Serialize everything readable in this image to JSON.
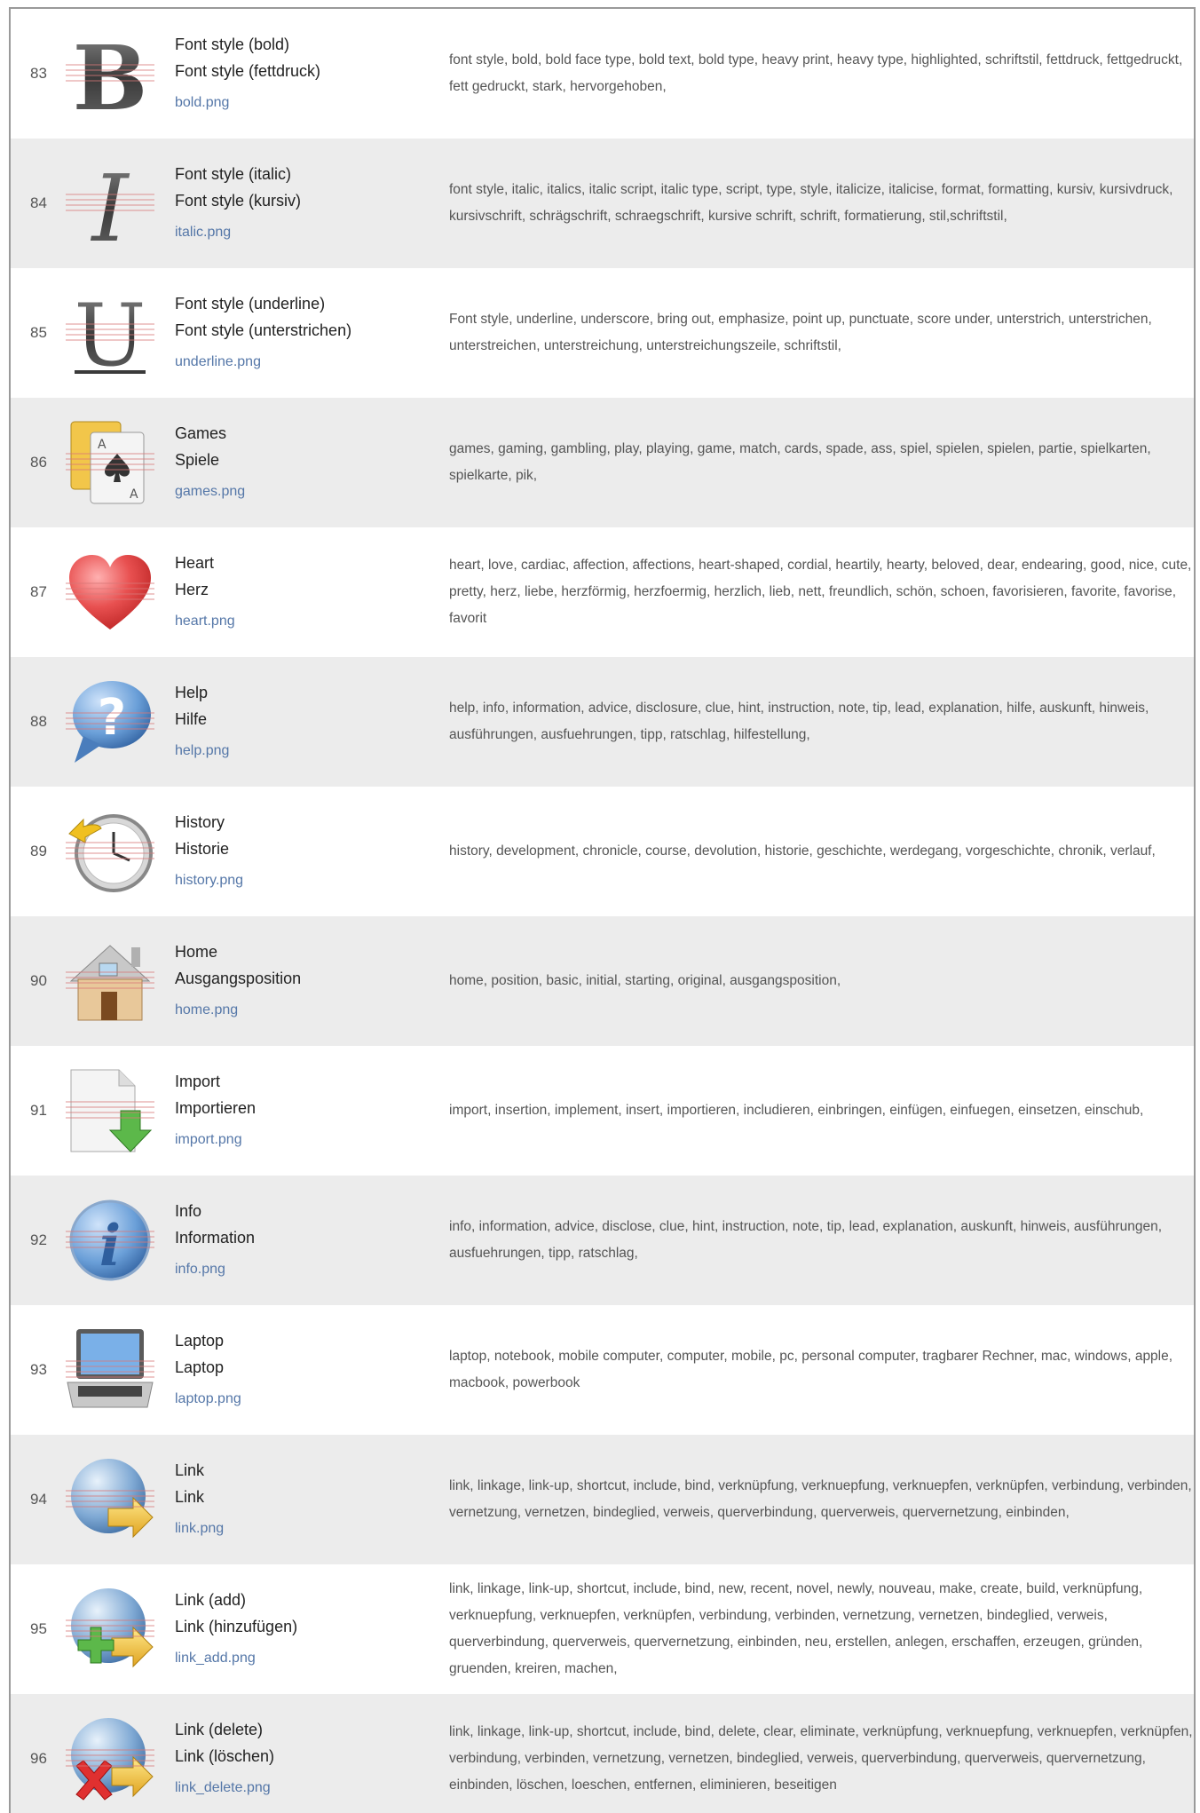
{
  "rows": [
    {
      "num": "83",
      "en": "Font style (bold)",
      "de": "Font style (fettdruck)",
      "file": "bold.png",
      "icon": "bold-icon",
      "keywords": "font style, bold, bold face type, bold text, bold type, heavy print, heavy type, highlighted, schriftstil, fettdruck, fettgedruckt, fett gedruckt, stark, hervorgehoben,"
    },
    {
      "num": "84",
      "en": "Font style (italic)",
      "de": "Font style (kursiv)",
      "file": "italic.png",
      "icon": "italic-icon",
      "keywords": "font style, italic, italics, italic script, italic type, script, type, style, italicize, italicise, format, formatting, kursiv, kursivdruck, kursivschrift, schrägschrift, schraegschrift, kursive schrift, schrift, formatierung, stil,schriftstil,"
    },
    {
      "num": "85",
      "en": "Font style (underline)",
      "de": "Font style (unterstrichen)",
      "file": "underline.png",
      "icon": "underline-icon",
      "keywords": "Font style, underline, underscore, bring out, emphasize, point up, punctuate, score under, unterstrich, unterstrichen, unterstreichen, unterstreichung, unterstreichungszeile, schriftstil,"
    },
    {
      "num": "86",
      "en": "Games",
      "de": "Spiele",
      "file": "games.png",
      "icon": "playing-cards-icon",
      "keywords": "games, gaming, gambling, play, playing, game, match, cards, spade, ass, spiel, spielen, spielen, partie, spielkarten, spielkarte, pik,"
    },
    {
      "num": "87",
      "en": "Heart",
      "de": "Herz",
      "file": "heart.png",
      "icon": "heart-icon",
      "keywords": "heart, love, cardiac, affection, affections, heart-shaped, cordial, heartily, hearty, beloved, dear, endearing, good, nice, cute, pretty, herz, liebe, herzförmig, herzfoermig, herzlich, lieb, nett, freundlich, schön, schoen, favorisieren, favorite, favorise, favorit"
    },
    {
      "num": "88",
      "en": "Help",
      "de": "Hilfe",
      "file": "help.png",
      "icon": "help-bubble-icon",
      "keywords": "help, info, information, advice, disclosure, clue, hint, instruction, note, tip, lead, explanation, hilfe, auskunft, hinweis, ausführungen, ausfuehrungen, tipp, ratschlag, hilfestellung,"
    },
    {
      "num": "89",
      "en": "History",
      "de": "Historie",
      "file": "history.png",
      "icon": "history-clock-icon",
      "keywords": "history, development, chronicle, course, devolution, historie, geschichte, werdegang, vorgeschichte, chronik, verlauf,"
    },
    {
      "num": "90",
      "en": "Home",
      "de": "Ausgangsposition",
      "file": "home.png",
      "icon": "house-icon",
      "keywords": "home, position, basic, initial, starting, original, ausgangsposition,"
    },
    {
      "num": "91",
      "en": "Import",
      "de": "Importieren",
      "file": "import.png",
      "icon": "import-document-icon",
      "keywords": "import, insertion, implement, insert, importieren, includieren, einbringen, einfügen, einfuegen, einsetzen, einschub,"
    },
    {
      "num": "92",
      "en": "Info",
      "de": "Information",
      "file": "info.png",
      "icon": "info-icon",
      "keywords": "info, information, advice, disclose, clue, hint, instruction, note, tip, lead, explanation, auskunft, hinweis, ausführungen, ausfuehrungen, tipp, ratschlag,"
    },
    {
      "num": "93",
      "en": "Laptop",
      "de": "Laptop",
      "file": "laptop.png",
      "icon": "laptop-icon",
      "keywords": "laptop, notebook, mobile computer, computer, mobile, pc, personal computer, tragbarer Rechner, mac, windows, apple, macbook, powerbook"
    },
    {
      "num": "94",
      "en": "Link",
      "de": "Link",
      "file": "link.png",
      "icon": "globe-link-icon",
      "keywords": "link, linkage, link-up, shortcut, include, bind, verknüpfung, verknuepfung, verknuepfen, verknüpfen, verbindung, verbinden, vernetzung, vernetzen, bindeglied, verweis, querverbindung, querverweis, quervernetzung, einbinden,"
    },
    {
      "num": "95",
      "en": "Link (add)",
      "de": "Link (hinzufügen)",
      "file": "link_add.png",
      "icon": "globe-link-add-icon",
      "keywords": "link, linkage, link-up, shortcut, include, bind, new, recent, novel, newly, nouveau, make, create, build, verknüpfung, verknuepfung, verknuepfen, verknüpfen, verbindung, verbinden, vernetzung, vernetzen, bindeglied, verweis, querverbindung, querverweis, quervernetzung, einbinden, neu, erstellen, anlegen, erschaffen, erzeugen, gründen, gruenden, kreiren, machen,"
    },
    {
      "num": "96",
      "en": "Link (delete)",
      "de": "Link (löschen)",
      "file": "link_delete.png",
      "icon": "globe-link-delete-icon",
      "keywords": "link, linkage, link-up, shortcut, include, bind, delete, clear, eliminate, verknüpfung, verknuepfung, verknuepfen, verknüpfen, verbindung, verbinden, vernetzung, vernetzen, bindeglied, verweis, querverbindung, querverweis, quervernetzung, einbinden, löschen, loeschen, entfernen, eliminieren, beseitigen"
    }
  ]
}
